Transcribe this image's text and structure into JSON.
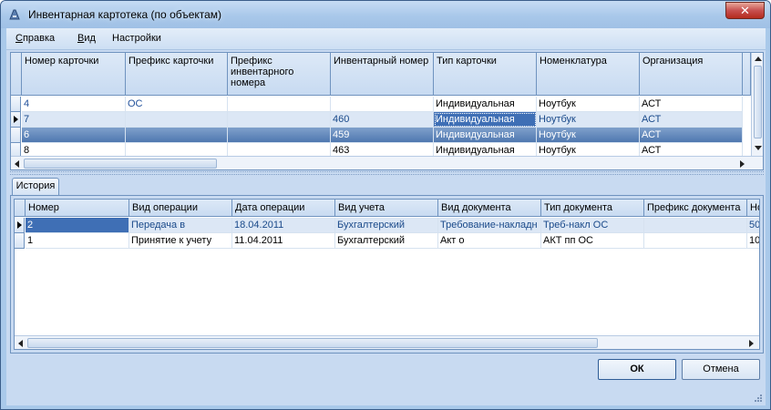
{
  "window": {
    "title": "Инвентарная картотека (по объектам)",
    "close_label": "✕"
  },
  "menu": [
    {
      "label": "Справка",
      "hotkey": "С",
      "rest": "правка"
    },
    {
      "label": "Вид",
      "hotkey": "В",
      "rest": "ид"
    },
    {
      "label": "Настройки",
      "hotkey": "Н",
      "rest": "астройки"
    }
  ],
  "cards_grid": {
    "columns": [
      "Номер карточки",
      "Префикс карточки",
      "Префикс инвентарного номера",
      "Инвентарный номер",
      "Тип карточки",
      "Номенклатура",
      "Организация"
    ],
    "rows": [
      [
        "4",
        "ОС",
        "",
        "",
        "Индивидуальная",
        "Ноутбук",
        "АСТ"
      ],
      [
        "7",
        "",
        "",
        "460",
        "Индивидуальная",
        "Ноутбук",
        "АСТ"
      ],
      [
        "6",
        "",
        "",
        "459",
        "Индивидуальная",
        "Ноутбук",
        "АСТ"
      ],
      [
        "8",
        "",
        "",
        "463",
        "Индивидуальная",
        "Ноутбук",
        "АСТ"
      ]
    ]
  },
  "history_tab": {
    "label": "История"
  },
  "history_grid": {
    "columns": [
      "Номер",
      "Вид операции",
      "Дата операции",
      "Вид учета",
      "Вид документа",
      "Тип документа",
      "Префикс документа",
      "Но"
    ],
    "rows": [
      [
        "2",
        "Передача в",
        "18.04.2011",
        "Бухгалтерский",
        "Требование-накладн",
        "Треб-накл ОС",
        "",
        "50"
      ],
      [
        "1",
        "Принятие к учету",
        "11.04.2011",
        "Бухгалтерский",
        "Акт о",
        "АКТ пп ОС",
        "",
        "10"
      ]
    ]
  },
  "buttons": {
    "ok": "ОК",
    "cancel": "Отмена"
  }
}
